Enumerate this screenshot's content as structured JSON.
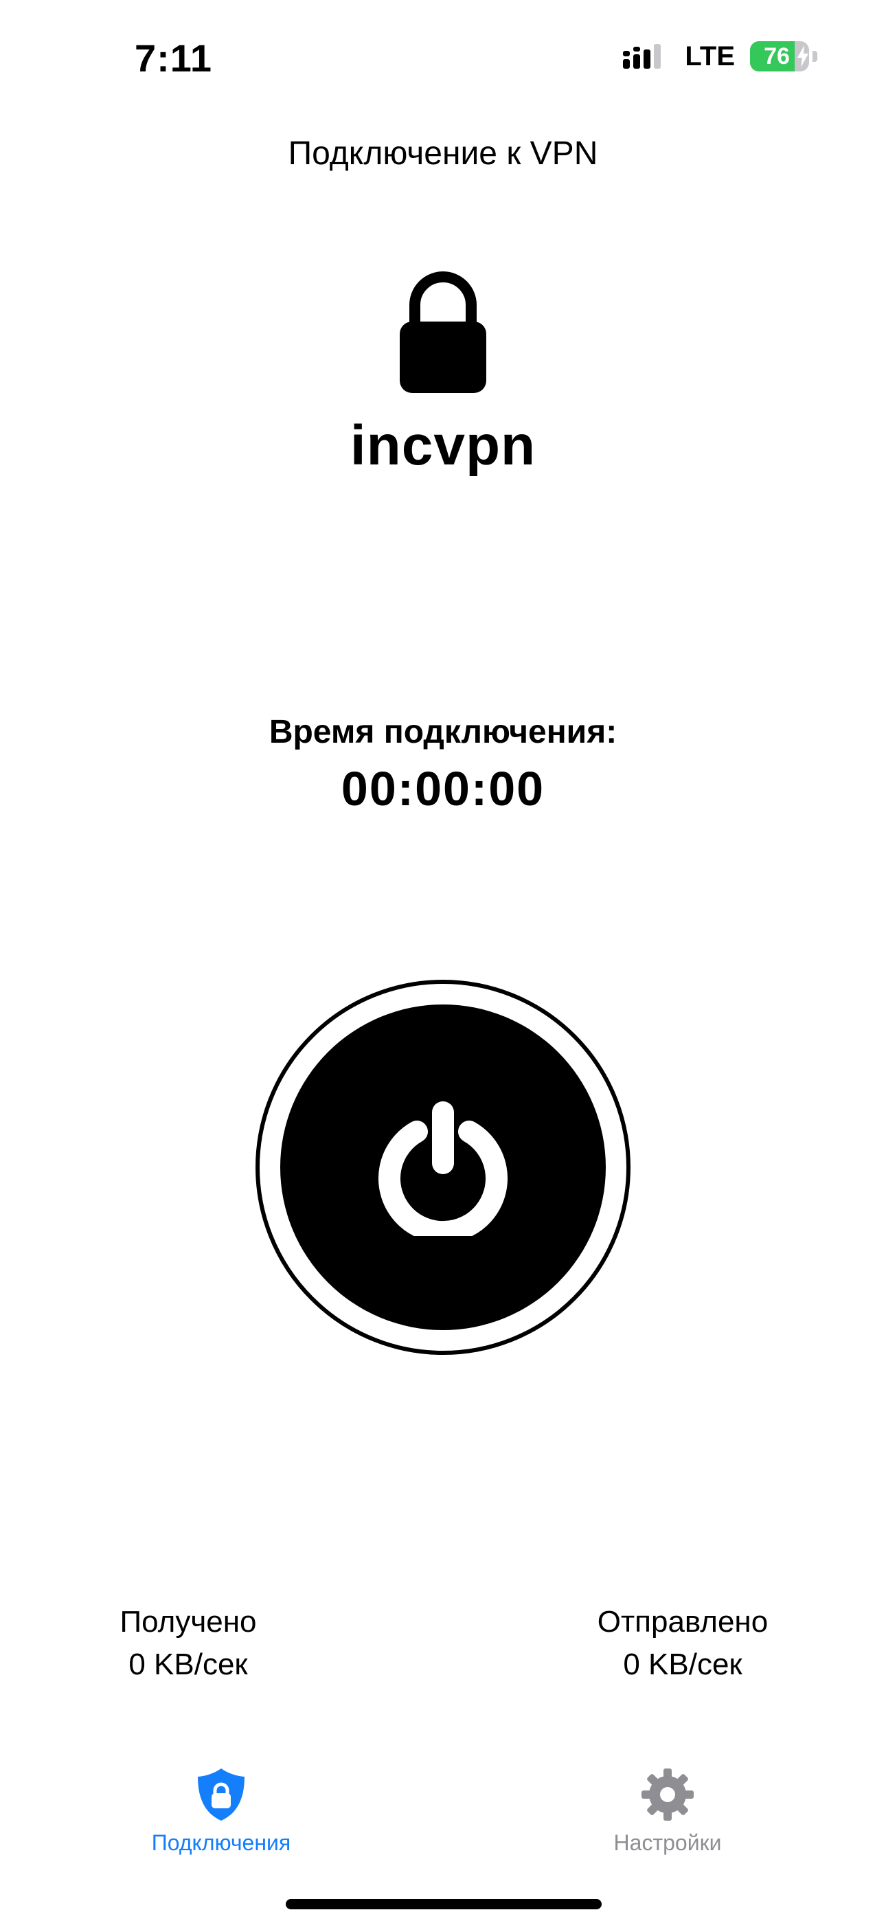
{
  "colors": {
    "accent": "#147EFB",
    "inactive": "#8E8E93",
    "battery_green": "#34C759",
    "foreground": "#000000",
    "background": "#FFFFFF"
  },
  "status_bar": {
    "time": "7:11",
    "network": "LTE",
    "battery_percent": "76",
    "battery_level": 0.76,
    "charging": true,
    "icons": [
      "signal-icon",
      "battery-icon",
      "charging-bolt-icon"
    ]
  },
  "header": {
    "title": "Подключение к VPN"
  },
  "main": {
    "icon": "lock-icon",
    "brand": "incvpn",
    "connection_time_label": "Время подключения:",
    "connection_time_value": "00:00:00",
    "power_icon": "power-icon"
  },
  "stats": {
    "received_label": "Получено",
    "received_value": "0 KB/сек",
    "sent_label": "Отправлено",
    "sent_value": "0 KB/сек"
  },
  "tab_bar": {
    "tabs": [
      {
        "label": "Подключения",
        "icon": "shield-lock-icon",
        "active": true
      },
      {
        "label": "Настройки",
        "icon": "gear-icon",
        "active": false
      }
    ]
  }
}
